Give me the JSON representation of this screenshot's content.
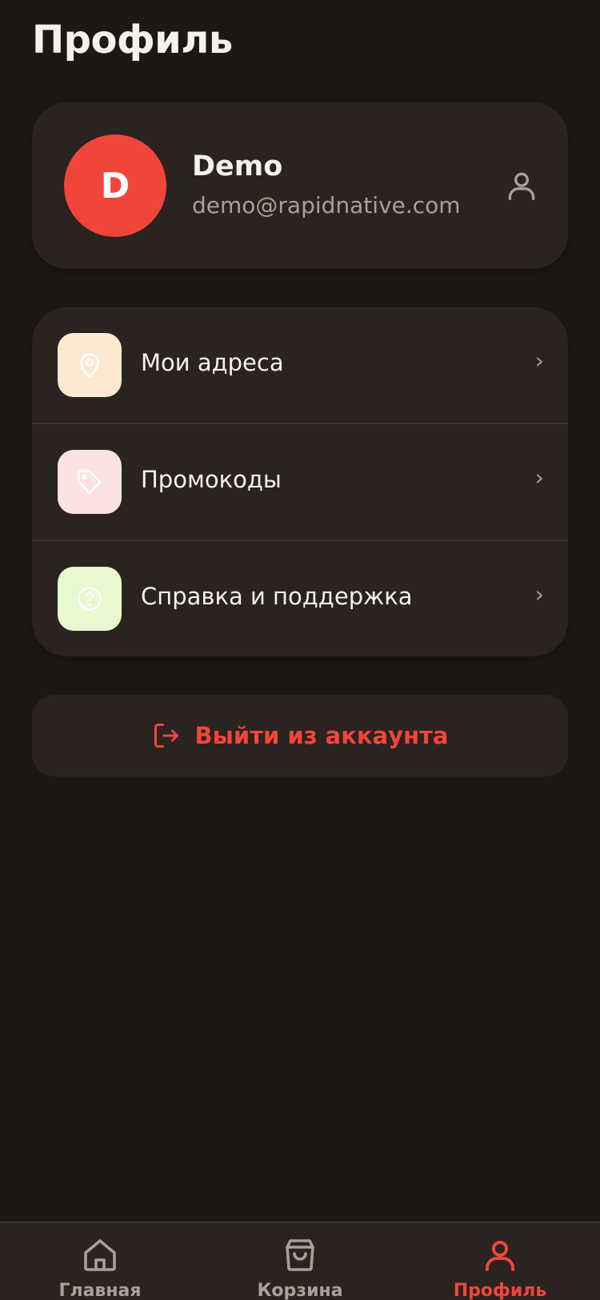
{
  "header": {
    "title": "Профиль"
  },
  "profile": {
    "initial": "D",
    "name": "Demo",
    "email": "demo@rapidnative.com",
    "avatar_color": "#f2453a",
    "action_icon": "user-icon"
  },
  "menu": {
    "items": [
      {
        "label": "Мои адреса",
        "icon": "location-pin-icon",
        "icon_bg": "#fde8d0",
        "chevron": "›"
      },
      {
        "label": "Промокоды",
        "icon": "tag-icon",
        "icon_bg": "#fde2e2",
        "chevron": "›"
      },
      {
        "label": "Справка и поддержка",
        "icon": "help-icon",
        "icon_bg": "#e8f8cf",
        "chevron": "›"
      }
    ]
  },
  "logout": {
    "label": "Выйти из аккаунта",
    "icon": "logout-icon",
    "color": "#f2453a"
  },
  "tabbar": {
    "tabs": [
      {
        "label": "Главная",
        "icon": "home-icon",
        "active": false
      },
      {
        "label": "Корзина",
        "icon": "shopping-bag-icon",
        "active": false
      },
      {
        "label": "Профиль",
        "icon": "user-icon",
        "active": true
      }
    ]
  },
  "colors": {
    "background": "#1c1816",
    "card": "#2a2320",
    "accent": "#f2453a",
    "muted_text": "#a8a09a"
  }
}
